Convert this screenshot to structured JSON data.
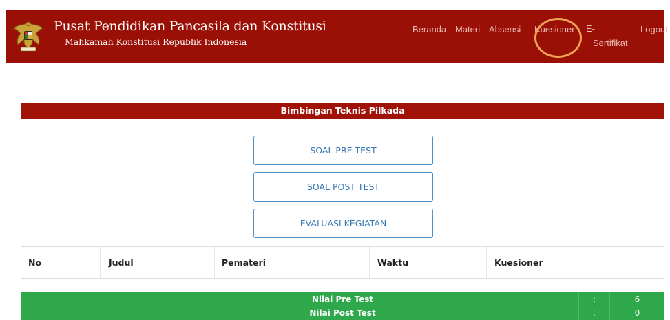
{
  "header": {
    "logo_icon": "garuda-emblem-icon",
    "title": "Pusat Pendidikan Pancasila dan Konstitusi",
    "subtitle": "Mahkamah Konstitusi Republik Indonesia",
    "background": "#9b1006"
  },
  "nav": {
    "beranda": "Beranda",
    "materi": "Materi",
    "absensi": "Absensi",
    "kuesioner": "Kuesioner",
    "sertifikat_line1": "E-",
    "sertifikat_line2": "Sertifikat",
    "logout": "Logout",
    "highlight_color": "#f0a255"
  },
  "panel": {
    "title": "Bimbingan Teknis Pilkada",
    "buttons": {
      "pre_test": "SOAL PRE TEST",
      "post_test": "SOAL POST TEST",
      "evaluasi": "EVALUASI KEGIATAN"
    }
  },
  "table": {
    "columns": [
      "No",
      "Judul",
      "Pemateri",
      "Waktu",
      "Kuesioner"
    ]
  },
  "scores": [
    {
      "label": "Nilai Pre Test",
      "separator": ":",
      "value": "6"
    },
    {
      "label": "Nilai Post Test",
      "separator": ":",
      "value": "0"
    }
  ],
  "colors": {
    "accent_red": "#a01207",
    "button_blue": "#3777b4",
    "score_green": "#2ea84a"
  }
}
